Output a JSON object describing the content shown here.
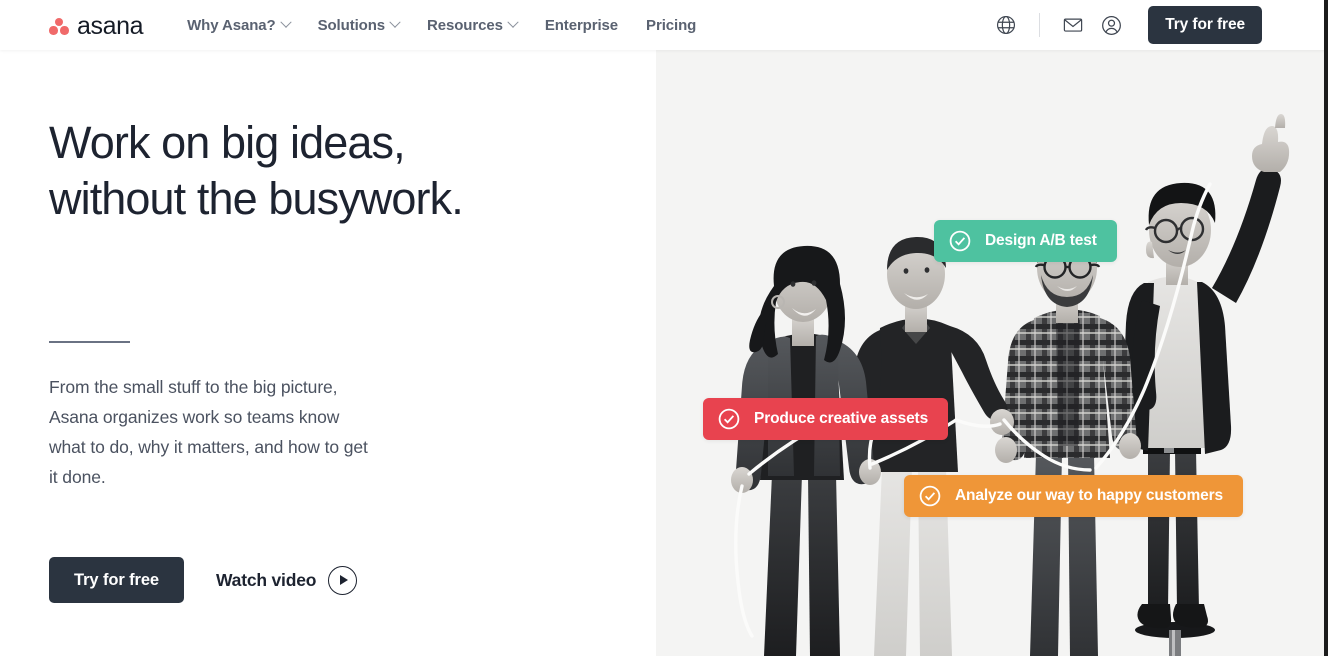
{
  "brand": {
    "name": "asana",
    "logo_icon": "asana-dots-logo",
    "dot_color": "#f06a6a",
    "wordmark_color": "#151b26"
  },
  "navbar": {
    "links": [
      {
        "label": "Why Asana?",
        "has_dropdown": true,
        "icon": "chevron-down-icon"
      },
      {
        "label": "Solutions",
        "has_dropdown": true,
        "icon": "chevron-down-icon"
      },
      {
        "label": "Resources",
        "has_dropdown": true,
        "icon": "chevron-down-icon"
      },
      {
        "label": "Enterprise",
        "has_dropdown": false,
        "icon": ""
      },
      {
        "label": "Pricing",
        "has_dropdown": false,
        "icon": ""
      }
    ],
    "icons": [
      {
        "name": "globe-icon",
        "title": "Language"
      },
      {
        "name": "envelope-icon",
        "title": "Contact"
      },
      {
        "name": "person-icon",
        "title": "Log in"
      }
    ],
    "cta_label": "Try for free",
    "cta_bg": "#2b3440"
  },
  "hero": {
    "headline": "Work on big ideas,\nwithout the busywork.",
    "subcopy": "From the small stuff to the big picture,\nAsana organizes work so teams know\nwhat to do, why it matters, and how to get\nit done.",
    "primary_cta": "Try for free",
    "secondary_cta": "Watch video",
    "play_icon": "play-circle-icon",
    "panel_bg": "#f4f4f3"
  },
  "task_pills": [
    {
      "label": "Design A/B test",
      "color": "#4ec2a0",
      "icon": "check-circle-icon"
    },
    {
      "label": "Produce creative assets",
      "color": "#e8434f",
      "icon": "check-circle-icon"
    },
    {
      "label": "Analyze our way to happy customers",
      "color": "#ef9638",
      "icon": "check-circle-icon"
    }
  ]
}
